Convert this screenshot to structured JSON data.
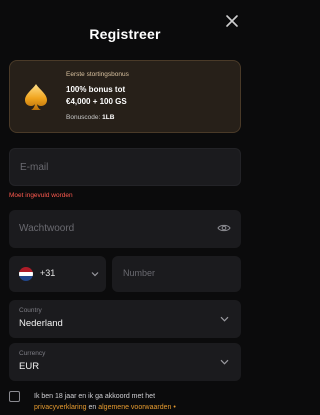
{
  "header": {
    "title": "Registreer"
  },
  "bonus": {
    "eyebrow": "Eerste stortingsbonus",
    "line1": "100% bonus tot",
    "line2": "€4,000 + 100 GS",
    "code_label": "Bonuscode:",
    "code_value": "1LB"
  },
  "form": {
    "email": {
      "placeholder": "E-mail",
      "value": "",
      "error": "Moet ingevuld worden"
    },
    "password": {
      "placeholder": "Wachtwoord",
      "value": ""
    },
    "phone": {
      "dial_code": "+31",
      "flag_colors": [
        "#ae1c28",
        "#ffffff",
        "#21468b"
      ],
      "number_placeholder": "Number"
    },
    "country": {
      "label": "Country",
      "value": "Nederland"
    },
    "currency": {
      "label": "Currency",
      "value": "EUR"
    },
    "consent": {
      "text": "Ik ben 18 jaar en ik ga akkoord met het",
      "link1": "privacyverklaring",
      "connector": "en",
      "link2": "algemene voorwaarden",
      "suffix": "•",
      "checked": false
    }
  },
  "colors": {
    "accent": "#e59a2f",
    "error": "#ff5a4f",
    "card_bg": "#272019",
    "field_bg": "#1b1b1e",
    "page_bg": "#0b0b0c"
  },
  "icons": [
    "close-icon",
    "spade-icon",
    "eye-icon",
    "chevron-down-icon",
    "netherlands-flag-icon"
  ]
}
